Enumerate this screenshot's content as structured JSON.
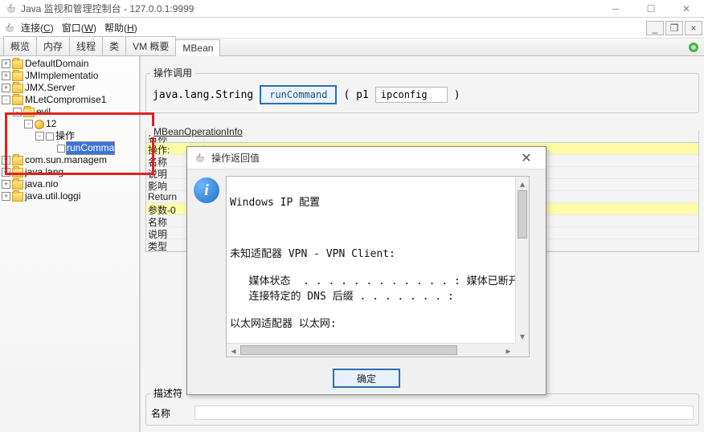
{
  "window": {
    "title": "Java 监视和管理控制台 - 127.0.0.1:9999"
  },
  "menu": {
    "connect": "连接",
    "connect_u": "C",
    "window": "窗口",
    "window_u": "W",
    "help": "帮助",
    "help_u": "H"
  },
  "tabs": [
    "概览",
    "内存",
    "线程",
    "类",
    "VM 概要",
    "MBean"
  ],
  "active_tab": 5,
  "tree": [
    {
      "d": 0,
      "t": "+",
      "i": "folder",
      "l": "DefaultDomain"
    },
    {
      "d": 0,
      "t": "+",
      "i": "folder",
      "l": "JMImplementatio"
    },
    {
      "d": 0,
      "t": "+",
      "i": "folder",
      "l": "JMX.Server"
    },
    {
      "d": 0,
      "t": "-",
      "i": "folder",
      "l": "MLetCompromise1"
    },
    {
      "d": 1,
      "t": "-",
      "i": "folder",
      "l": "evil"
    },
    {
      "d": 2,
      "t": "-",
      "i": "bean",
      "l": "12"
    },
    {
      "d": 3,
      "t": "-",
      "i": "leaf",
      "l": "操作"
    },
    {
      "d": 4,
      "t": "",
      "i": "leaf",
      "l": "runComma",
      "sel": true
    },
    {
      "d": 0,
      "t": "+",
      "i": "folder",
      "l": "com.sun.managem"
    },
    {
      "d": 0,
      "t": "+",
      "i": "folder",
      "l": "java.lang"
    },
    {
      "d": 0,
      "t": "+",
      "i": "folder",
      "l": "java.nio"
    },
    {
      "d": 0,
      "t": "+",
      "i": "folder",
      "l": "java.util.loggi"
    }
  ],
  "invoke": {
    "title": "操作调用",
    "return_type": "java.lang.String",
    "button": "runCommand",
    "paren_l": "( p1",
    "param_value": "ipconfig",
    "paren_r": ")"
  },
  "info_section_title": "MBeanOperationInfo",
  "info_rows": [
    {
      "k": "名称",
      "y": false,
      "hdr": true
    },
    {
      "k": "操作:",
      "y": true
    },
    {
      "k": "名称",
      "y": false
    },
    {
      "k": "说明",
      "y": false
    },
    {
      "k": "影响",
      "y": false
    },
    {
      "k": "Return",
      "y": false
    },
    {
      "k": "参数-0",
      "y": true
    },
    {
      "k": "名称",
      "y": false
    },
    {
      "k": "说明",
      "y": false
    },
    {
      "k": "类型",
      "y": false
    }
  ],
  "descriptor": {
    "title": "描述符",
    "name_label": "名称"
  },
  "dialog": {
    "title": "操作返回值",
    "content_lines": [
      "",
      "Windows IP 配置",
      "",
      "",
      "",
      "未知适配器 VPN - VPN Client:",
      "",
      "   媒体状态  . . . . . . . . . . . . : 媒体已断开连接",
      "   连接特定的 DNS 后缀 . . . . . . . :",
      "",
      "以太网适配器 以太网:",
      ""
    ],
    "ok": "确定"
  }
}
